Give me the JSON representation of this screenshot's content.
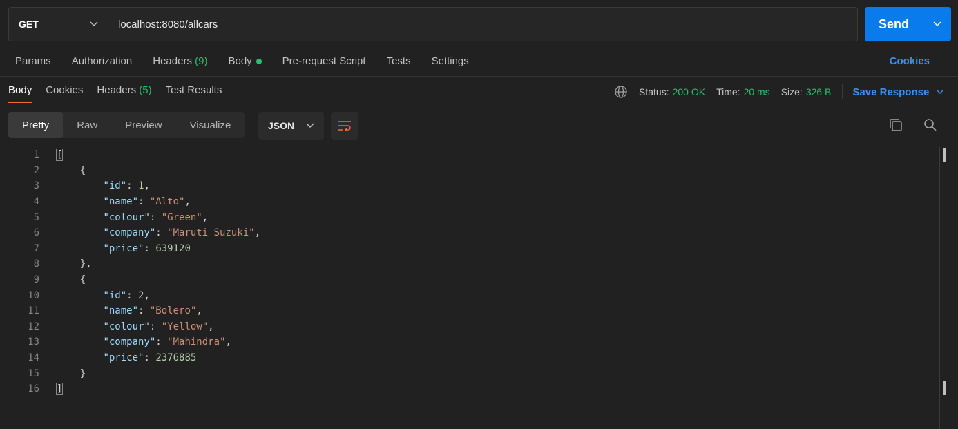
{
  "request": {
    "method": "GET",
    "url": "localhost:8080/allcars",
    "send_label": "Send"
  },
  "request_tabs": {
    "params": "Params",
    "authorization": "Authorization",
    "headers": "Headers",
    "headers_count": "(9)",
    "body": "Body",
    "pre_request": "Pre-request Script",
    "tests": "Tests",
    "settings": "Settings",
    "cookies": "Cookies"
  },
  "response_tabs": {
    "body": "Body",
    "cookies": "Cookies",
    "headers": "Headers",
    "headers_count": "(5)",
    "test_results": "Test Results"
  },
  "status": {
    "status_label": "Status:",
    "status_value": "200 OK",
    "time_label": "Time:",
    "time_value": "20 ms",
    "size_label": "Size:",
    "size_value": "326 B",
    "save_response": "Save Response"
  },
  "view": {
    "pretty": "Pretty",
    "raw": "Raw",
    "preview": "Preview",
    "visualize": "Visualize",
    "format": "JSON"
  },
  "code_lines": [
    {
      "n": "1"
    },
    {
      "n": "2"
    },
    {
      "n": "3"
    },
    {
      "n": "4"
    },
    {
      "n": "5"
    },
    {
      "n": "6"
    },
    {
      "n": "7"
    },
    {
      "n": "8"
    },
    {
      "n": "9"
    },
    {
      "n": "10"
    },
    {
      "n": "11"
    },
    {
      "n": "12"
    },
    {
      "n": "13"
    },
    {
      "n": "14"
    },
    {
      "n": "15"
    },
    {
      "n": "16"
    }
  ],
  "cars": [
    {
      "id": "1",
      "name": "\"Alto\"",
      "colour": "\"Green\"",
      "company": "\"Maruti Suzuki\"",
      "price": "639120"
    },
    {
      "id": "2",
      "name": "\"Bolero\"",
      "colour": "\"Yellow\"",
      "company": "\"Mahindra\"",
      "price": "2376885"
    }
  ],
  "keys": {
    "id": "\"id\"",
    "name": "\"name\"",
    "colour": "\"colour\"",
    "company": "\"company\"",
    "price": "\"price\""
  },
  "colors": {
    "accent_blue": "#097bed",
    "status_green": "#2dbd6e",
    "active_tab_underline": "#f26b3a"
  }
}
